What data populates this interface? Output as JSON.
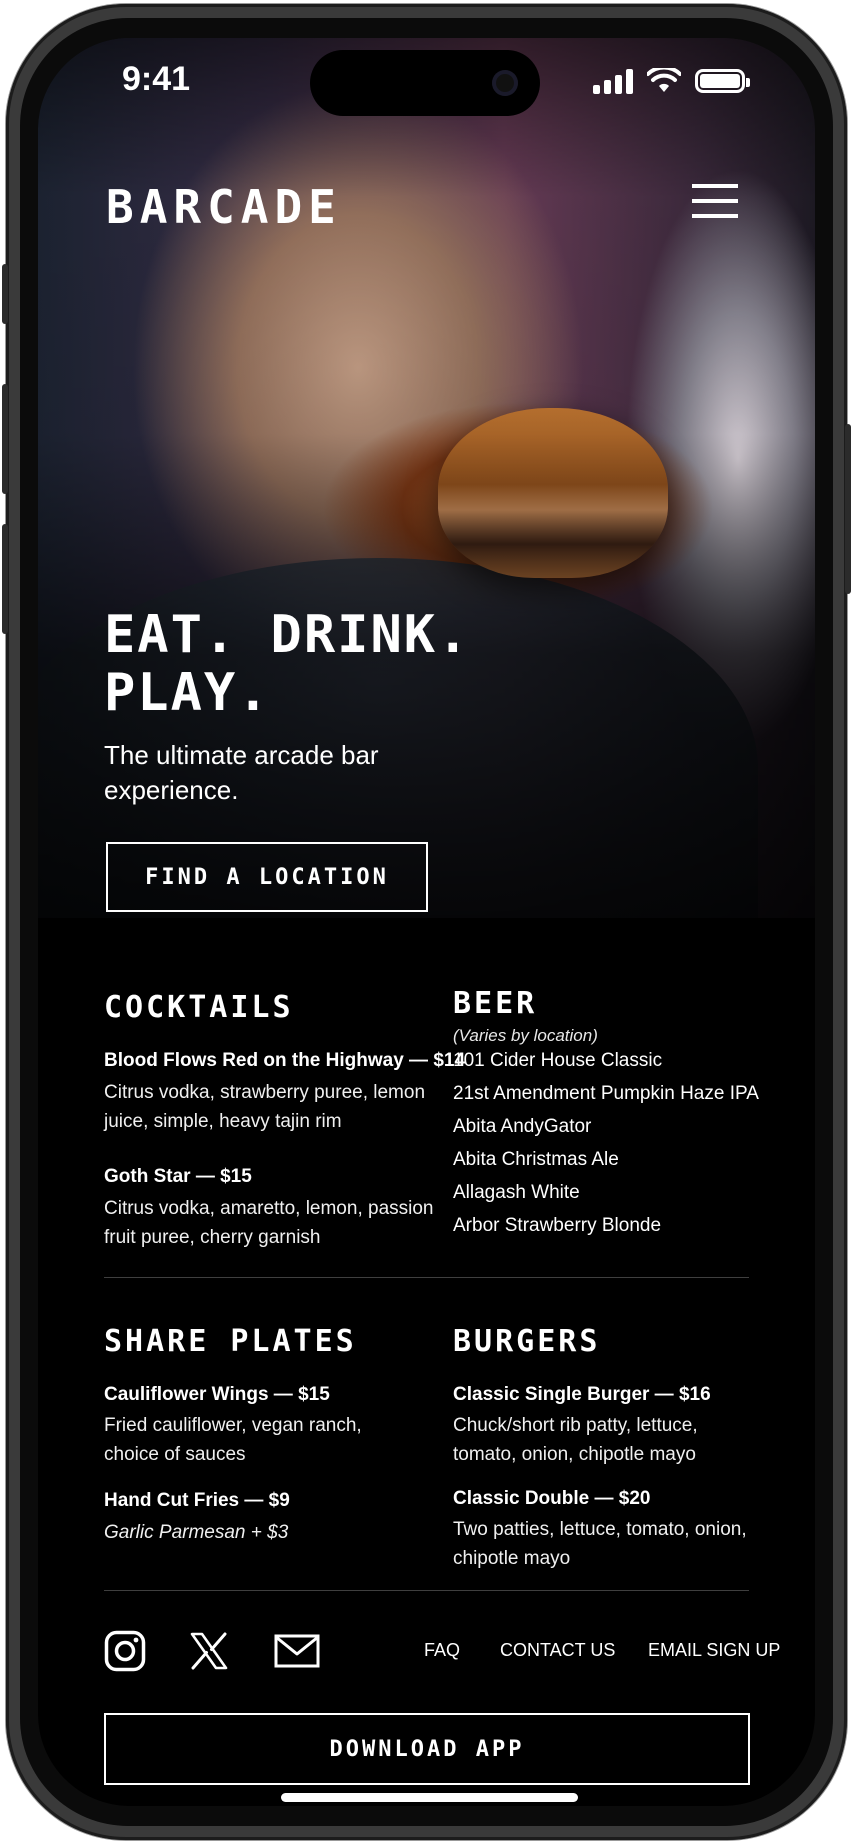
{
  "status_bar": {
    "time": "9:41"
  },
  "header": {
    "brand": "BARCADE",
    "menu_icon": "hamburger-menu-icon"
  },
  "hero": {
    "title": "EAT. DRINK. PLAY.",
    "subtitle": "The ultimate arcade bar experience.",
    "cta_label": "FIND A LOCATION"
  },
  "menu": {
    "cocktails": {
      "title": "COCKTAILS",
      "items": [
        {
          "name": "Blood Flows Red on the Highway — $14",
          "desc": "Citrus vodka, strawberry puree, lemon juice, simple, heavy tajin rim"
        },
        {
          "name": "Goth Star — $15",
          "desc": "Citrus vodka, amaretto, lemon, passion fruit puree, cherry garnish"
        }
      ]
    },
    "beer": {
      "title": "BEER",
      "note": "(Varies by location)",
      "items": [
        "101 Cider House Classic",
        "21st Amendment Pumpkin Haze IPA",
        "Abita AndyGator",
        "Abita Christmas Ale",
        "Allagash White",
        "Arbor Strawberry Blonde"
      ]
    },
    "share_plates": {
      "title": "SHARE PLATES",
      "items": [
        {
          "name": "Cauliflower Wings — $15",
          "desc": "Fried cauliflower, vegan ranch, choice of sauces"
        },
        {
          "name": "Hand Cut Fries — $9",
          "desc": "Garlic Parmesan + $3"
        }
      ]
    },
    "burgers": {
      "title": "BURGERS",
      "items": [
        {
          "name": "Classic Single Burger — $16",
          "desc": "Chuck/short rib patty, lettuce, tomato, onion, chipotle mayo"
        },
        {
          "name": "Classic Double — $20",
          "desc": "Two patties, lettuce, tomato, onion, chipotle mayo"
        }
      ]
    }
  },
  "footer": {
    "social_icons": [
      "instagram-icon",
      "x-icon",
      "email-icon"
    ],
    "links": [
      "FAQ",
      "CONTACT US",
      "EMAIL SIGN UP"
    ],
    "download_label": "DOWNLOAD APP"
  }
}
